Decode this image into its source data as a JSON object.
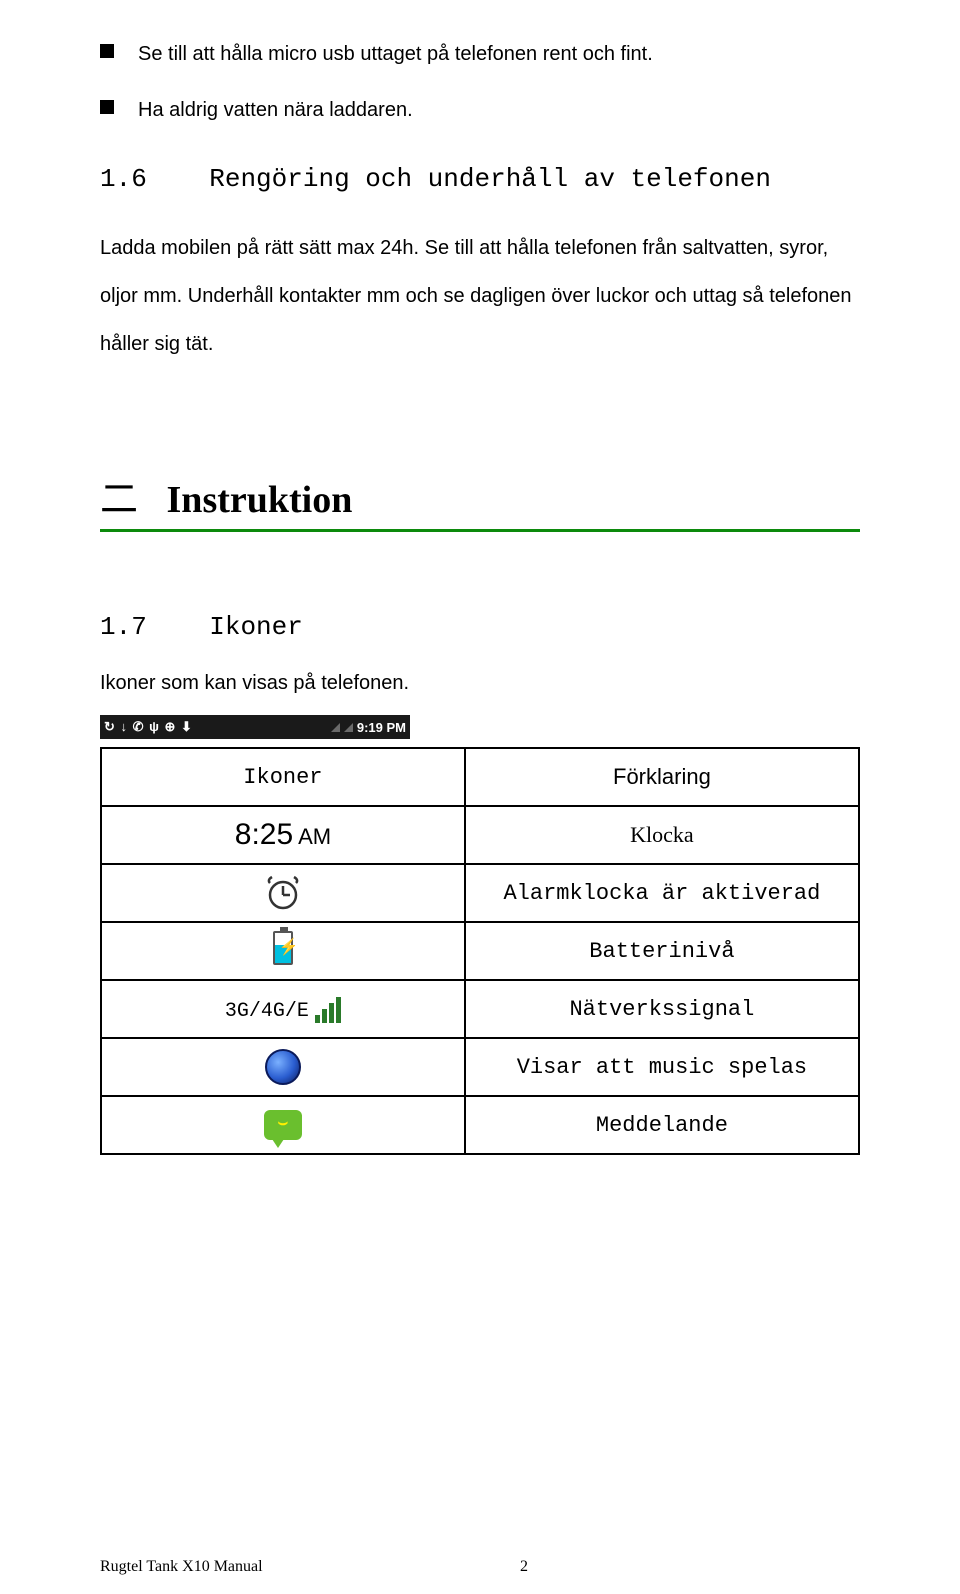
{
  "bullets": [
    "Se till att hålla micro usb uttaget på telefonen rent och fint.",
    "Ha aldrig vatten nära laddaren."
  ],
  "section": {
    "num": "1.6",
    "title": "Rengöring och underhåll av telefonen"
  },
  "paragraph": "Ladda mobilen på rätt sätt max 24h. Se till att hålla telefonen från saltvatten, syror, oljor mm. Underhåll kontakter mm och se dagligen över luckor och uttag så telefonen håller sig tät.",
  "chapter": {
    "prefix": "二",
    "title": "Instruktion"
  },
  "subsection": {
    "num": "1.7",
    "title": "Ikoner"
  },
  "intro": "Ikoner som kan visas på telefonen.",
  "statusbar": {
    "left_glyphs": "↻ ↓ ✆ ψ   ⊕ ⬇",
    "time": "9:19 PM"
  },
  "table": {
    "header_left": "Ikoner",
    "header_right": "Förklaring",
    "rows": [
      {
        "icon_type": "clock",
        "clock_text": "8:25",
        "clock_ampm": "AM",
        "desc": "Klocka",
        "desc_class": "cell-small-serif"
      },
      {
        "icon_type": "alarm",
        "desc": "Alarmklocka är aktiverad",
        "desc_class": "cell-desc"
      },
      {
        "icon_type": "battery",
        "desc": "Batterinivå",
        "desc_class": "cell-desc"
      },
      {
        "icon_type": "network",
        "net_label": "3G/4G/E",
        "desc": "Nätverkssignal",
        "desc_class": "cell-desc"
      },
      {
        "icon_type": "speaker",
        "desc": "Visar att music spelas",
        "desc_class": "cell-desc"
      },
      {
        "icon_type": "message",
        "desc": "Meddelande",
        "desc_class": "cell-desc"
      }
    ]
  },
  "footer": {
    "title": "Rugtel Tank X10 Manual",
    "page": "2"
  }
}
